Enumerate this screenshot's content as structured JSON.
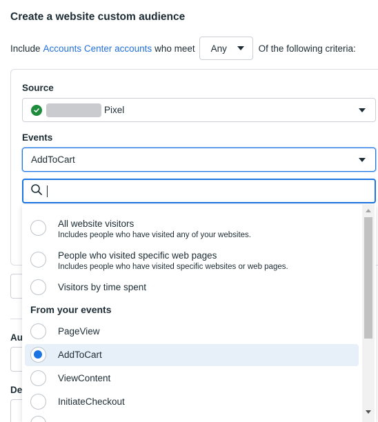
{
  "title": "Create a website custom audience",
  "include": {
    "prefix": "Include",
    "link": "Accounts Center accounts",
    "middle": "who meet",
    "any_value": "Any",
    "suffix": "Of the following criteria:"
  },
  "source": {
    "label": "Source",
    "value_suffix": "Pixel"
  },
  "events": {
    "label": "Events",
    "value": "AddToCart"
  },
  "search": {
    "value": ""
  },
  "dropdown": {
    "options": [
      {
        "title": "All website visitors",
        "desc": "Includes people who have visited any of your websites."
      },
      {
        "title": "People who visited specific web pages",
        "desc": "Includes people who have visited specific websites or web pages."
      },
      {
        "title": "Visitors by time spent",
        "desc": ""
      }
    ],
    "group_heading": "From your events",
    "events": [
      {
        "title": "PageView",
        "selected": false
      },
      {
        "title": "AddToCart",
        "selected": true
      },
      {
        "title": "ViewContent",
        "selected": false
      },
      {
        "title": "InitiateCheckout",
        "selected": false
      }
    ]
  },
  "background_fragments": {
    "au": "Au",
    "de": "De"
  },
  "colors": {
    "link": "#216fdb",
    "accent": "#1b74e4",
    "success": "#1e8c3a",
    "selected_row": "#e7f0f9"
  }
}
